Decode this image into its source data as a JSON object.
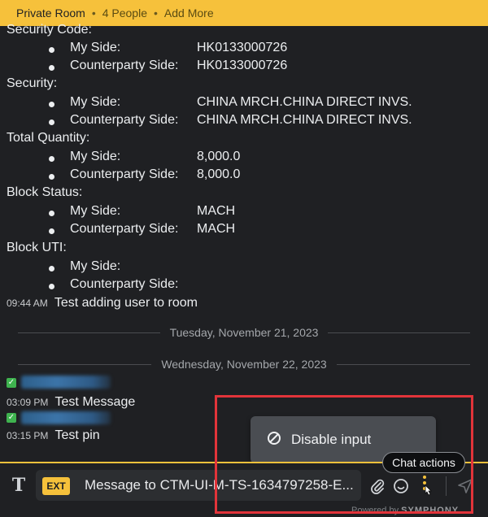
{
  "header": {
    "room_type": "Private Room",
    "people": "4 People",
    "add_more": "Add More"
  },
  "sections": [
    {
      "label": "Security Code:",
      "rows": [
        {
          "key": "My Side:",
          "value": "HK0133000726"
        },
        {
          "key": "Counterparty Side:",
          "value": "HK0133000726"
        }
      ]
    },
    {
      "label": "Security:",
      "rows": [
        {
          "key": "My Side:",
          "value": "CHINA MRCH.CHINA DIRECT INVS."
        },
        {
          "key": "Counterparty Side:",
          "value": "CHINA MRCH.CHINA DIRECT INVS."
        }
      ]
    },
    {
      "label": "Total Quantity:",
      "rows": [
        {
          "key": "My Side:",
          "value": "8,000.0"
        },
        {
          "key": "Counterparty Side:",
          "value": "8,000.0"
        }
      ]
    },
    {
      "label": "Block Status:",
      "rows": [
        {
          "key": "My Side:",
          "value": "MACH"
        },
        {
          "key": "Counterparty Side:",
          "value": "MACH"
        }
      ]
    },
    {
      "label": "Block UTI:",
      "rows": [
        {
          "key": "My Side:",
          "value": ""
        },
        {
          "key": "Counterparty Side:",
          "value": ""
        }
      ]
    }
  ],
  "messages": [
    {
      "time": "09:44 AM",
      "text": "Test adding user to room"
    },
    {
      "time": "03:09 PM",
      "text": "Test Message"
    },
    {
      "time": "03:15 PM",
      "text": "Test pin"
    }
  ],
  "dates": [
    "Tuesday, November 21, 2023",
    "Wednesday, November 22, 2023"
  ],
  "popover": {
    "label": "Disable input"
  },
  "tooltip": {
    "label": "Chat actions"
  },
  "composer": {
    "badge": "EXT",
    "text": "Message to CTM-UI-M-TS-1634797258-E...",
    "powered_prefix": "Powered by",
    "powered_brand": "SYMPHONY"
  },
  "colors": {
    "accent": "#f6c13b",
    "background": "#1f2023",
    "highlight": "#e2343a",
    "check": "#3fb34f"
  }
}
